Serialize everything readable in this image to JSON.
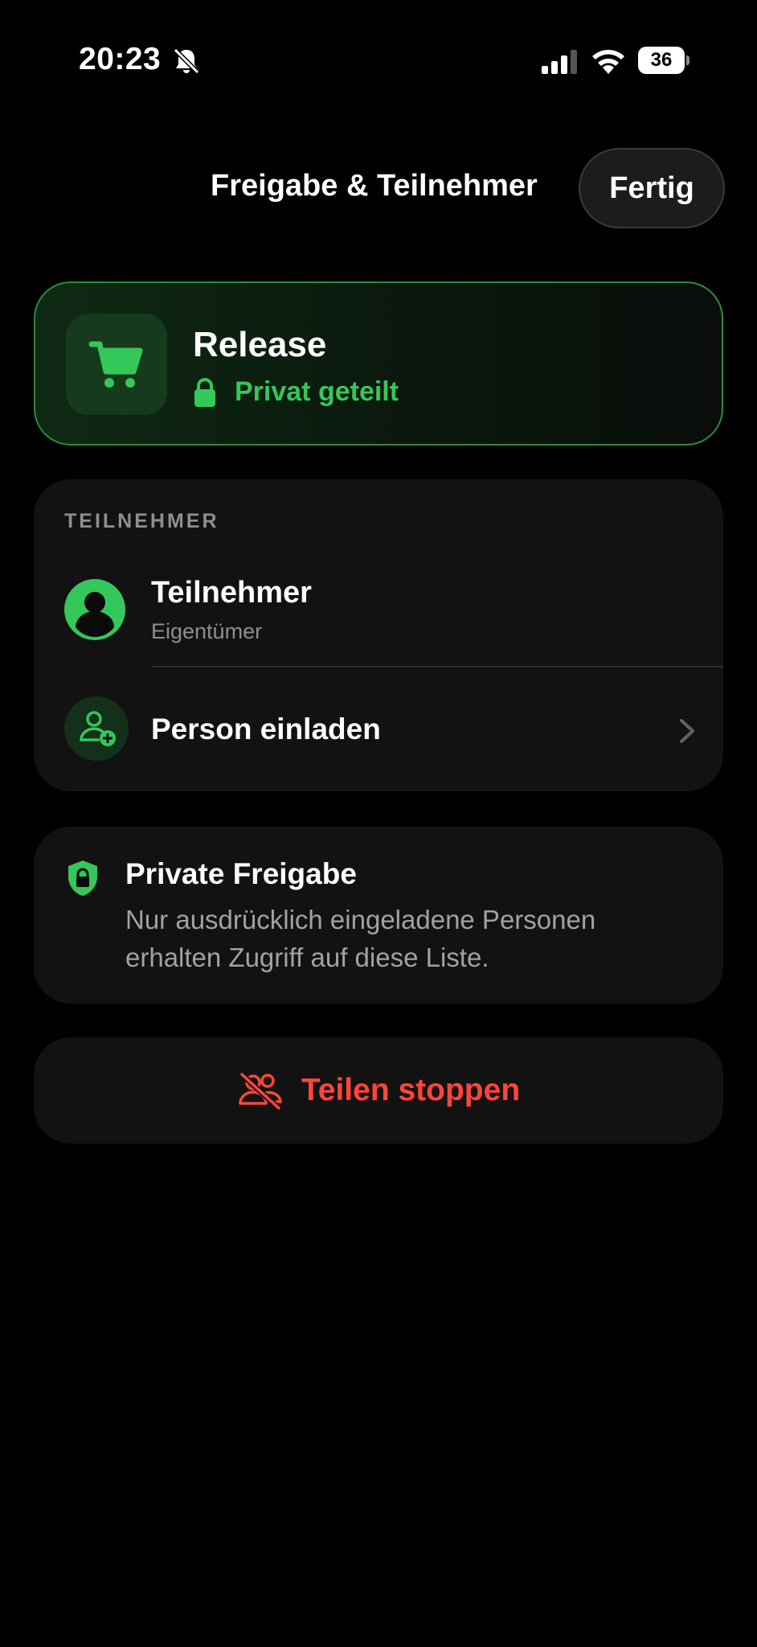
{
  "status_bar": {
    "time": "20:23",
    "battery": "36"
  },
  "header": {
    "title": "Freigabe & Teilnehmer",
    "done_label": "Fertig"
  },
  "list_card": {
    "name": "Release",
    "sharing_status": "Privat geteilt"
  },
  "participants": {
    "section_title": "TEILNEHMER",
    "items": [
      {
        "name": "Teilnehmer",
        "role": "Eigentümer"
      }
    ],
    "invite_label": "Person einladen"
  },
  "privacy": {
    "title": "Private Freigabe",
    "description": "Nur ausdrücklich eingeladene Personen erhalten Zugriff auf diese Liste."
  },
  "stop_sharing": {
    "label": "Teilen stoppen"
  },
  "colors": {
    "accent_green": "#34c759",
    "danger_red": "#ff453a",
    "card_bg": "#121212"
  }
}
